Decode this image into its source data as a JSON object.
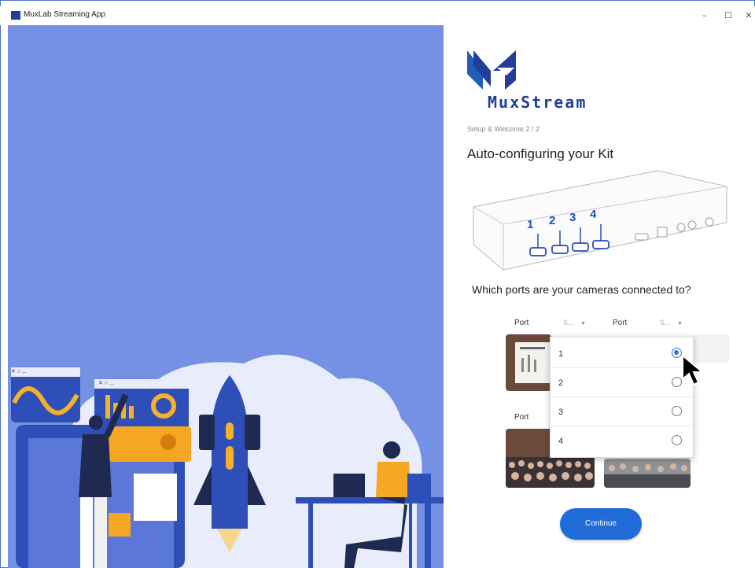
{
  "window": {
    "title": "MuxLab Streaming App",
    "minimize": "–",
    "maximize": "☐",
    "close": "✕"
  },
  "brand": {
    "logo_text": "MuxStream"
  },
  "setup": {
    "step": "Setup & Welcome 2 / 2",
    "heading": "Auto-configuring your Kit",
    "question": "Which ports are your cameras connected to?",
    "device_port_numbers": [
      "1",
      "2",
      "3",
      "4"
    ]
  },
  "ports": {
    "label": "Port",
    "select_placeholder": "S...",
    "dropdown_options": [
      {
        "label": "1",
        "selected": true
      },
      {
        "label": "2",
        "selected": false
      },
      {
        "label": "3",
        "selected": false
      },
      {
        "label": "4",
        "selected": false
      }
    ]
  },
  "continue_label": "Continue",
  "illustration": {
    "window_dots": "✕ ○ ..."
  },
  "colors": {
    "accent": "#1f6bd8",
    "left_bg": "#7591e3",
    "brand": "#213e9b"
  }
}
